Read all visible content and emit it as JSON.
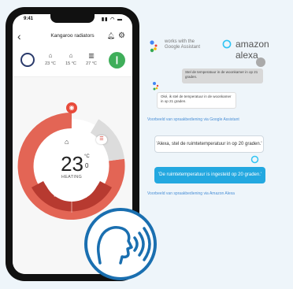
{
  "phone": {
    "status_time": "9:41",
    "status_icons": "▮▮ ◠ ▬",
    "app_title": "Kangaroo radiators",
    "sensors": [
      {
        "icon": "house-icon",
        "value": "23 °C"
      },
      {
        "icon": "house-outline-icon",
        "value": "15 °C"
      },
      {
        "icon": "radiator-icon",
        "value": "27 °C"
      }
    ],
    "thermostat": {
      "temperature_int": "23",
      "temperature_dec": "0",
      "unit": "°C",
      "mode": "HEATING",
      "minus_label": "−",
      "plus_label": "+"
    }
  },
  "assistant": {
    "google_logo_text_line1": "works with the",
    "google_logo_text_line2": "Google Assistant",
    "alexa_logo_text": "amazon alexa",
    "user_message": "Stel de temperatuur in de woonkamer in op 21 graden.",
    "ga_reply": "Oké, ik stel de temperatuur in de woonkamer in op 21 graden.",
    "ga_caption": "Voorbeeld van spraakbediening via Google Assistant",
    "alexa_question": "'Alexa, stel de ruimtetemperatuur in op 20 graden.'",
    "alexa_answer": "'De ruimtetemperatuur is ingesteld op 20 graden.'",
    "alexa_caption": "Voorbeeld van spraakbediening via Amazon Alexa"
  },
  "colors": {
    "dial_red": "#e04a3c",
    "dial_dark_red": "#b73a30",
    "alexa_blue": "#23a8e0",
    "app_green": "#3fae5a",
    "voice_icon_blue": "#1a6fb0"
  }
}
